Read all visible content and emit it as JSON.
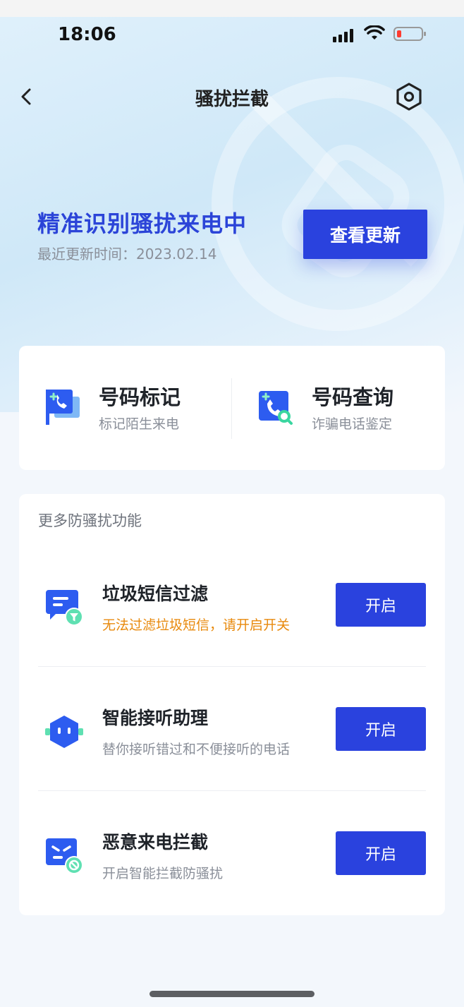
{
  "status_bar": {
    "time": "18:06"
  },
  "nav": {
    "title": "骚扰拦截"
  },
  "hero": {
    "title": "精准识别骚扰来电中",
    "subtitle": "最近更新时间：2023.02.14",
    "update_button": "查看更新"
  },
  "quick_actions": [
    {
      "title": "号码标记",
      "subtitle": "标记陌生来电",
      "icon": "phone-flag-icon"
    },
    {
      "title": "号码查询",
      "subtitle": "诈骗电话鉴定",
      "icon": "phone-search-icon"
    }
  ],
  "more": {
    "title": "更多防骚扰功能",
    "features": [
      {
        "title": "垃圾短信过滤",
        "subtitle": "无法过滤垃圾短信，请开启开关",
        "button": "开启",
        "icon": "sms-filter-icon"
      },
      {
        "title": "智能接听助理",
        "subtitle": "替你接听错过和不便接听的电话",
        "button": "开启",
        "icon": "robot-assistant-icon"
      },
      {
        "title": "恶意来电拦截",
        "subtitle": "开启智能拦截防骚扰",
        "button": "开启",
        "icon": "malicious-block-icon"
      }
    ]
  },
  "colors": {
    "primary": "#2a42de",
    "warning": "#e8890c",
    "hero_bg": "#d8ecf9"
  }
}
